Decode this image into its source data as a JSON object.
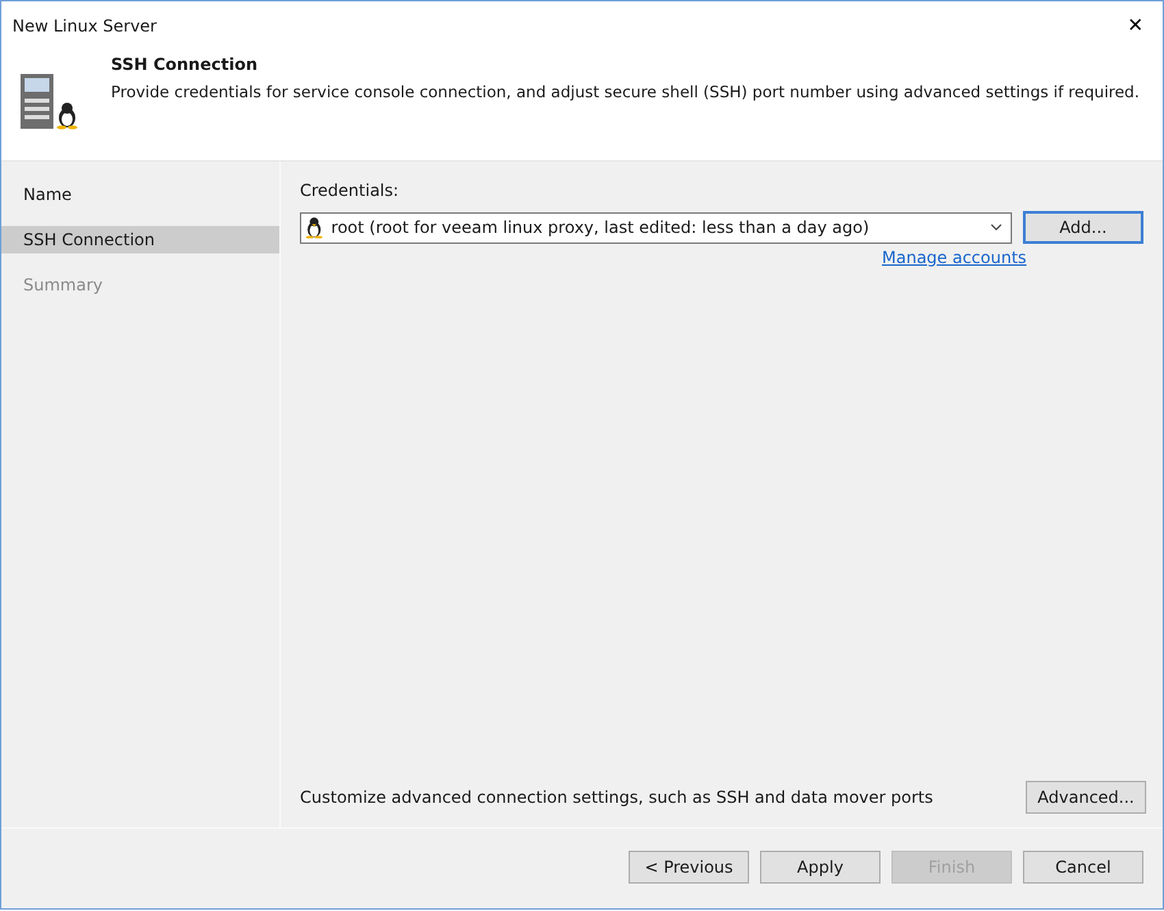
{
  "window": {
    "title": "New Linux Server",
    "close": "✕"
  },
  "header": {
    "title": "SSH Connection",
    "description": "Provide credentials for service console connection, and adjust secure shell (SSH) port number using advanced settings if required."
  },
  "steps": [
    {
      "label": "Name",
      "selected": false,
      "disabled": false
    },
    {
      "label": "SSH Connection",
      "selected": true,
      "disabled": false
    },
    {
      "label": "Summary",
      "selected": false,
      "disabled": true
    }
  ],
  "credentials": {
    "label": "Credentials:",
    "value": "root (root for veeam linux proxy, last edited: less than a day ago)",
    "add_button": {
      "label": "Add...",
      "focused": true
    },
    "link": "Manage accounts"
  },
  "advanced": {
    "text": "Customize advanced connection settings, such as SSH and data mover ports",
    "button": {
      "label": "Advanced...",
      "focused": false
    }
  },
  "buttons": [
    {
      "label": "< Previous",
      "disabled": false
    },
    {
      "label": "Apply",
      "disabled": false
    },
    {
      "label": "Finish",
      "disabled": true
    },
    {
      "label": "Cancel",
      "disabled": false
    }
  ]
}
